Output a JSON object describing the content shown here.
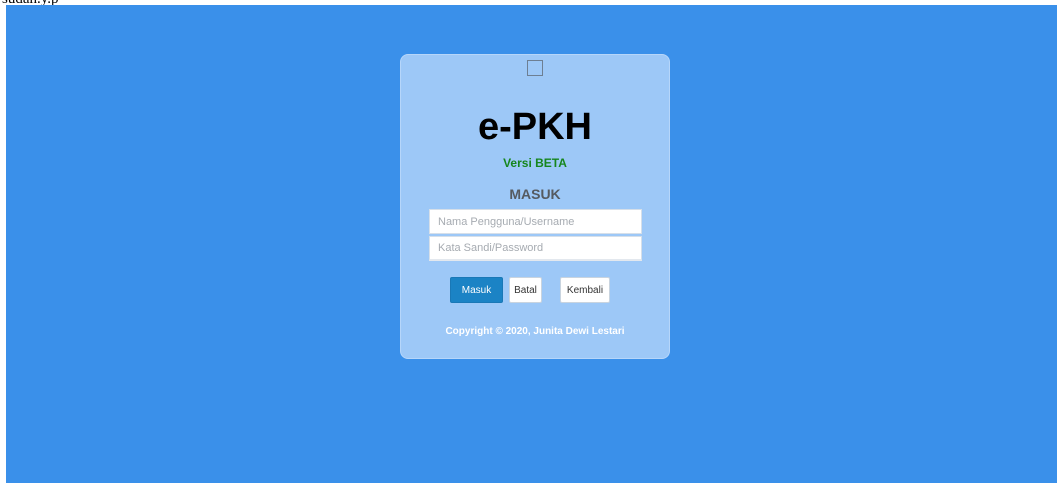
{
  "page": {
    "stray_text": "sudah.y.p"
  },
  "login": {
    "title": "e-PKH",
    "subtitle": "Versi BETA",
    "heading": "MASUK",
    "username_placeholder": "Nama Pengguna/Username",
    "username_value": "",
    "password_placeholder": "Kata Sandi/Password",
    "password_value": "",
    "submit_label": "Masuk",
    "cancel_label": "Batal",
    "back_label": "Kembali",
    "copyright": "Copyright © 2020, Junita Dewi Lestari"
  },
  "icons": {
    "logo": "broken-image-icon"
  },
  "colors": {
    "background": "#3a90ea",
    "card": "#9dc8f7",
    "primary_button": "#1b83c5",
    "subtitle": "#16861d"
  }
}
